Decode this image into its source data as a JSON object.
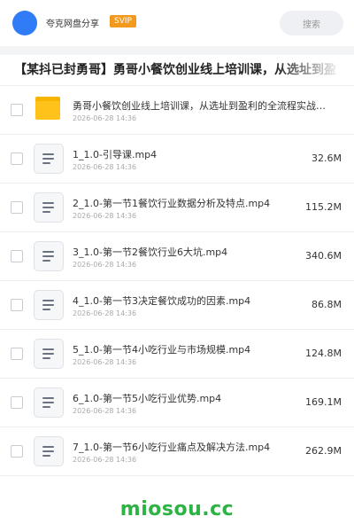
{
  "header": {
    "share_name": "夸克网盘分享",
    "svip_label": "SVIP",
    "search_label": "搜索"
  },
  "share_title": "【某抖已封勇哥】勇哥小餐饮创业线上培训课，从选址到盈",
  "folder": {
    "name": "勇哥小餐饮创业线上培训课，从选址到盈利的全流程实战…",
    "date": "2026-06-28 14:36"
  },
  "files": [
    {
      "name": "1_1.0-引导课.mp4",
      "date": "2026-06-28 14:36",
      "size": "32.6M"
    },
    {
      "name": "2_1.0-第一节1餐饮行业数据分析及特点.mp4",
      "date": "2026-06-28 14:36",
      "size": "115.2M"
    },
    {
      "name": "3_1.0-第一节2餐饮行业6大坑.mp4",
      "date": "2026-06-28 14:36",
      "size": "340.6M"
    },
    {
      "name": "4_1.0-第一节3决定餐饮成功的因素.mp4",
      "date": "2026-06-28 14:36",
      "size": "86.8M"
    },
    {
      "name": "5_1.0-第一节4小吃行业与市场规模.mp4",
      "date": "2026-06-28 14:36",
      "size": "124.8M"
    },
    {
      "name": "6_1.0-第一节5小吃行业优势.mp4",
      "date": "2026-06-28 14:36",
      "size": "169.1M"
    },
    {
      "name": "7_1.0-第一节6小吃行业痛点及解决方法.mp4",
      "date": "2026-06-28 14:36",
      "size": "262.9M"
    }
  ],
  "watermark": "miosou.cc",
  "colors": {
    "accent": "#2f7cf6",
    "svip": "#f39a1e",
    "folder": "#ffc21a",
    "watermark": "#2db244"
  },
  "icons": {
    "folder": "folder-icon",
    "file": "video-file-icon",
    "avatar": "avatar"
  }
}
